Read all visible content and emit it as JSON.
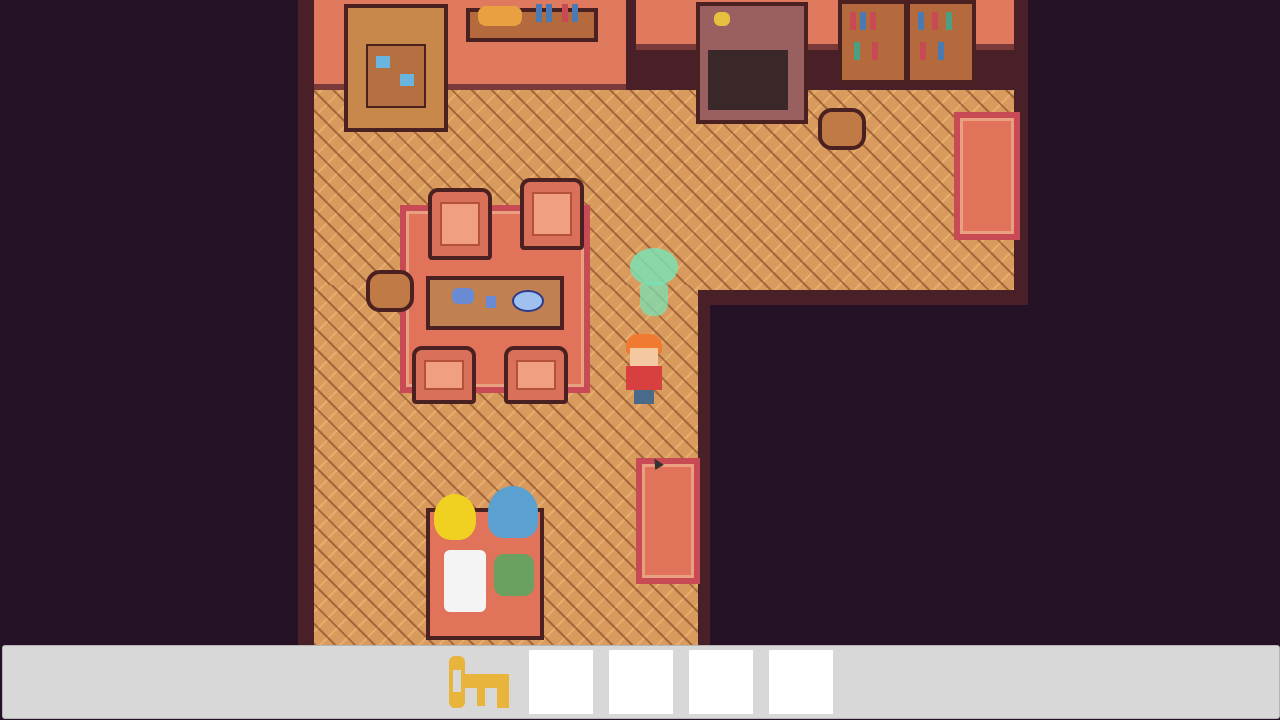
{
  "game": {
    "scene": "indoor-room",
    "player": "red-haired-kid",
    "npc": "green-ghost-girl",
    "plush_toys": [
      "yellow-chick",
      "blue-ghost",
      "white-dog",
      "green-frog"
    ]
  },
  "inventory": {
    "slots": [
      {
        "item": "key-icon",
        "filled": true
      },
      {
        "item": "",
        "filled": false
      },
      {
        "item": "",
        "filled": false
      },
      {
        "item": "",
        "filled": false
      },
      {
        "item": "",
        "filled": false
      }
    ],
    "key_color": "#e8b43c"
  },
  "colors": {
    "background": "#241125",
    "floor": "#d99a5e",
    "rug_border": "#c84a55",
    "inventory_bar": "#d8d8d8"
  }
}
